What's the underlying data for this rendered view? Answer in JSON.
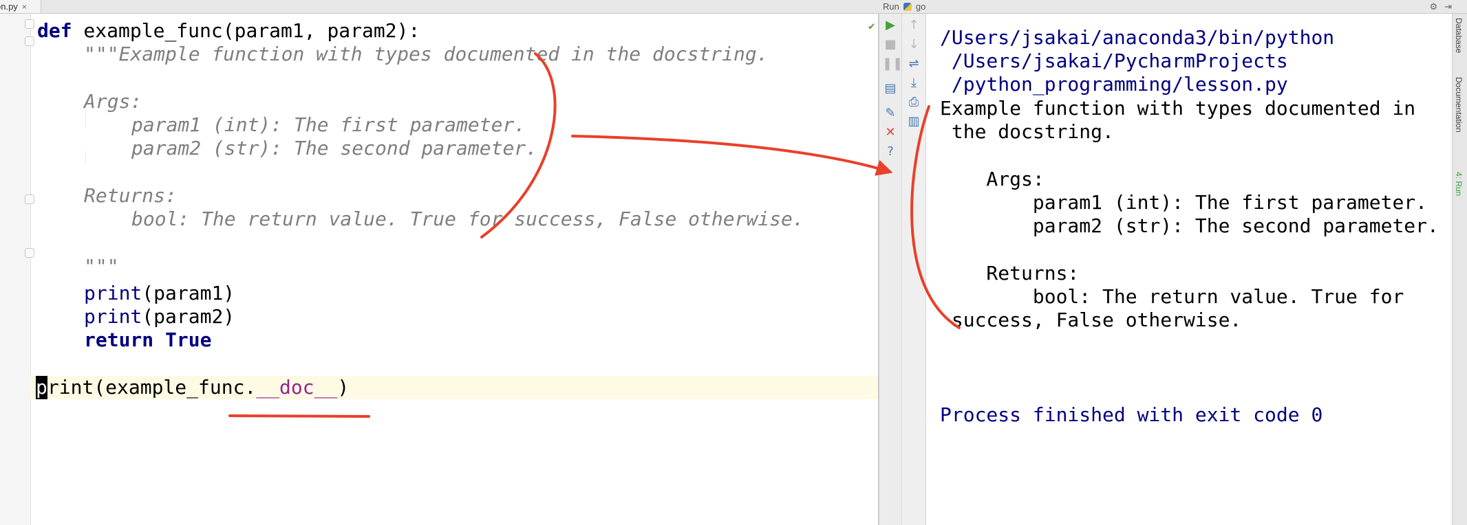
{
  "editor": {
    "file_tab": {
      "name": "on.py",
      "close": "×"
    },
    "lines": {
      "l1_kw": "def",
      "l1_rest": " example_func(param1, param2):",
      "l2_quote": "\"\"\"",
      "l2_text": "Example function with types documented in the docstring.",
      "l4": "Args:",
      "l5": "param1 (int): The first parameter.",
      "l6": "param2 (str): The second parameter.",
      "l8": "Returns:",
      "l9": "bool: The return value. True for success, False otherwise.",
      "l11": "\"\"\"",
      "l12_func": "print",
      "l12_rest": "(param1)",
      "l13_func": "print",
      "l13_rest": "(param2)",
      "l14_kw": "return True",
      "l16_caret": "p",
      "l16_a": "rint(example_func.",
      "l16_magic": "__doc__",
      "l16_b": ")"
    }
  },
  "run_panel": {
    "title": "Run",
    "config_name": "go",
    "console": {
      "cmd1": "/Users/jsakai/anaconda3/bin/python",
      "cmd2": " /Users/jsakai/PycharmProjects",
      "cmd3": " /python_programming/lesson.py",
      "out1": "Example function with types documented in",
      "out2": " the docstring.",
      "out4": "    Args:",
      "out5": "        param1 (int): The first parameter.",
      "out6": "        param2 (str): The second parameter.",
      "out8": "    Returns:",
      "out9": "        bool: The return value. True for",
      "out10": " success, False otherwise.",
      "exit": "Process finished with exit code 0"
    }
  },
  "side_tabs": {
    "database": "Database",
    "documentation": "Documentation",
    "run": "4: Run"
  },
  "colors": {
    "annotation": "#e8402b",
    "keyword": "#000080",
    "docstring": "#7f7f7f",
    "magic": "#94238f",
    "current_line": "#fffae4"
  }
}
